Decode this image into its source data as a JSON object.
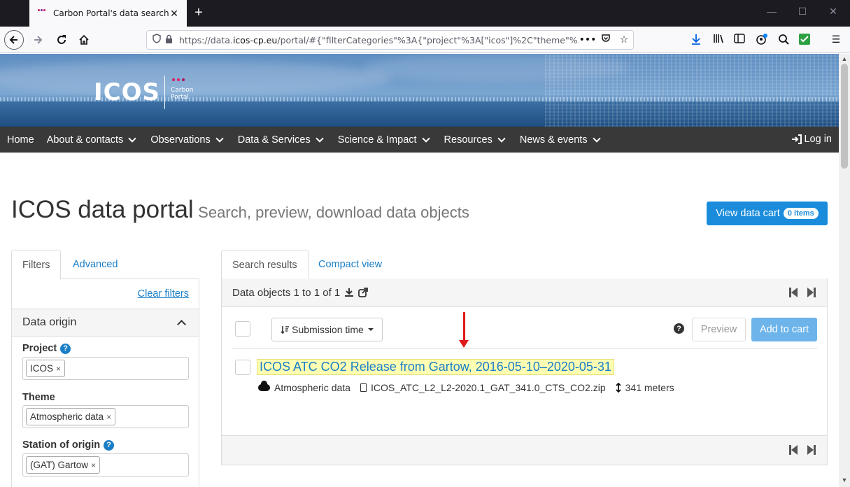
{
  "browser": {
    "tab_title": "Carbon Portal's data search",
    "url_prefix": "https://data.",
    "url_domain": "icos-cp.eu",
    "url_rest": "/portal/#{\"filterCategories\"%3A{\"project\"%3A[\"icos\"]%2C\"theme\"%3"
  },
  "site": {
    "logo_text": "ICOS",
    "logo_sub1": "Carbon",
    "logo_sub2": "Portal",
    "menu": [
      "Home",
      "About & contacts",
      "Observations",
      "Data & Services",
      "Science & Impact",
      "Resources",
      "News & events"
    ],
    "login": "Log in"
  },
  "page": {
    "title": "ICOS data portal",
    "subtitle": "Search, preview, download data objects",
    "cart_button": "View data cart",
    "cart_badge": "0 items"
  },
  "filters": {
    "tabs": [
      "Filters",
      "Advanced"
    ],
    "clear": "Clear filters",
    "section": "Data origin",
    "project_label": "Project",
    "project_value": "ICOS",
    "theme_label": "Theme",
    "theme_value": "Atmospheric data",
    "station_label": "Station of origin",
    "station_value": "(GAT) Gartow"
  },
  "results": {
    "tabs": [
      "Search results",
      "Compact view"
    ],
    "count_text": "Data objects 1 to 1 of 1",
    "sort_label": "Submission time",
    "preview": "Preview",
    "add_to_cart": "Add to cart",
    "items": [
      {
        "title": "ICOS ATC CO2 Release from Gartow, 2016-05-10–2020-05-31",
        "theme": "Atmospheric data",
        "file": "ICOS_ATC_L2_L2-2020.1_GAT_341.0_CTS_CO2.zip",
        "height": "341 meters"
      }
    ]
  },
  "colors": {
    "accent": "#1a8cdb",
    "link": "#1a7fc7",
    "highlight": "#ffffb3",
    "menu_bg": "#393939",
    "annotation_arrow": "#e01a1a"
  }
}
